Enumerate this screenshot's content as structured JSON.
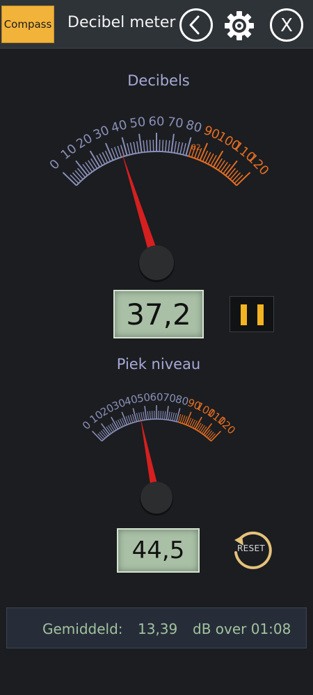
{
  "topbar": {
    "compass_label": "Compass",
    "title": "Decibel meter",
    "back_icon": "chevron-left-icon",
    "settings_icon": "gear-icon",
    "close_icon": "close-icon",
    "close_glyph": "X"
  },
  "main_gauge": {
    "title": "Decibels",
    "labels": [
      "0",
      "10",
      "20",
      "30",
      "40",
      "50",
      "60",
      "70",
      "80",
      "90",
      "100",
      "110",
      "120"
    ],
    "scale_min": 0,
    "scale_max": 120,
    "warn_start": 82,
    "warn_marker": "82",
    "needle_value": 37.2,
    "readout": "37,2"
  },
  "peak_gauge": {
    "title": "Piek niveau",
    "labels": [
      "0",
      "10",
      "20",
      "30",
      "40",
      "50",
      "60",
      "70",
      "80",
      "90",
      "100",
      "110",
      "120"
    ],
    "scale_min": 0,
    "scale_max": 120,
    "warn_start": 82,
    "needle_value": 44.5,
    "readout": "44,5"
  },
  "controls": {
    "pause_icon": "pause-icon",
    "reset_label": "RESET",
    "reset_icon": "reset-icon"
  },
  "average": {
    "label": "Gemiddeld:",
    "value": "13,39",
    "unit_text": "dB over 01:08"
  },
  "colors": {
    "background": "#1b1d20",
    "topbar": "#2e3338",
    "compass_button": "#f2b33a",
    "scale_normal": "#8a8fb8",
    "scale_warning": "#e46d22",
    "needle": "#d61f1f",
    "readout_bg": "#a9c0a6",
    "pause_bars": "#f2b421",
    "average_text": "#a1c39f"
  }
}
